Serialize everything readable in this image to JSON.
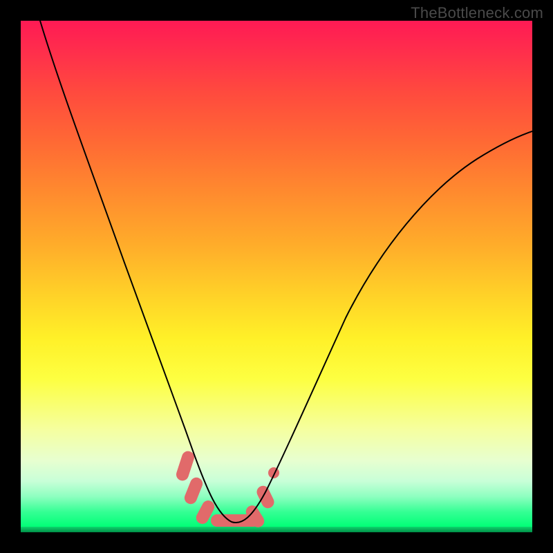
{
  "attribution": "TheBottleneck.com",
  "colors": {
    "background": "#000000",
    "gradient_top": "#ff1a54",
    "gradient_bottom": "#00ff76",
    "marker": "#e16a6a",
    "curve": "#000000"
  },
  "chart_data": {
    "type": "line",
    "title": "",
    "xlabel": "",
    "ylabel": "",
    "xlim": [
      0,
      100
    ],
    "ylim": [
      0,
      100
    ],
    "grid": false,
    "legend": false,
    "series": [
      {
        "name": "bottleneck-curve",
        "x": [
          0,
          5,
          10,
          15,
          20,
          24,
          28,
          31,
          33,
          35,
          37,
          39,
          41,
          43,
          45,
          50,
          55,
          62,
          70,
          80,
          90,
          100
        ],
        "y": [
          100,
          89,
          77,
          65,
          52,
          40,
          28,
          18,
          11,
          6,
          3,
          1.5,
          1.5,
          3,
          6,
          14,
          24,
          38,
          51,
          63,
          72,
          78
        ]
      }
    ],
    "markers": {
      "name": "optimal-region",
      "x": [
        32,
        33.5,
        35,
        37,
        39,
        41,
        43,
        45,
        46.5
      ],
      "y": [
        14,
        9,
        5.5,
        2.5,
        1.5,
        1.5,
        2.5,
        5.5,
        9
      ]
    },
    "note": "x/y are read in percent of plot width/height; y=0 is bottom, y=100 is top; values estimated from pixel positions since chart has no axes or ticks"
  }
}
